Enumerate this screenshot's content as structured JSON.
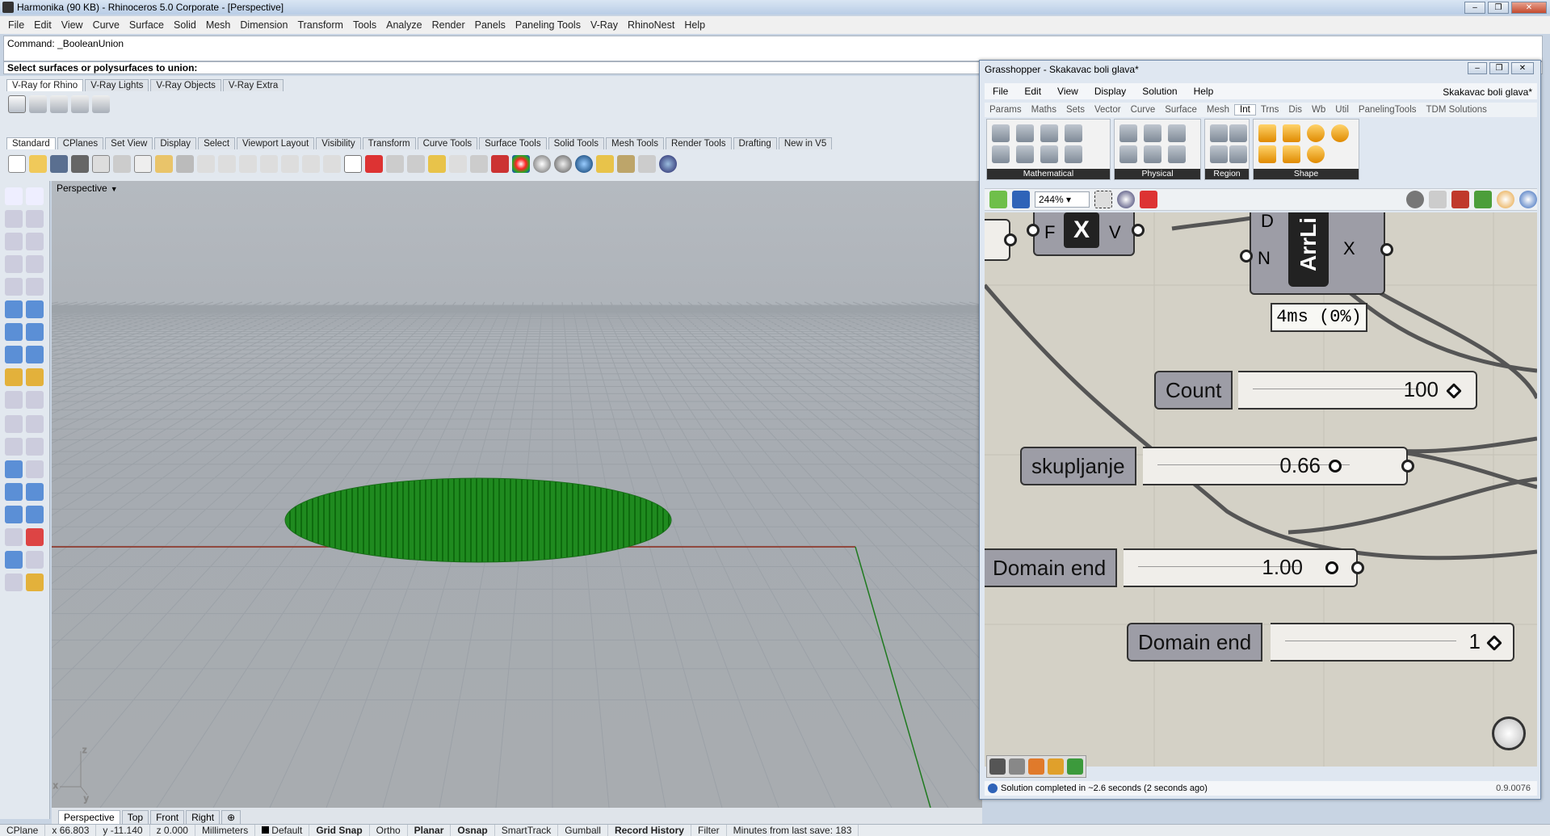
{
  "rhino": {
    "title": "Harmonika (90 KB) - Rhinoceros  5.0 Corporate - [Perspective]",
    "menu": [
      "File",
      "Edit",
      "View",
      "Curve",
      "Surface",
      "Solid",
      "Mesh",
      "Dimension",
      "Transform",
      "Tools",
      "Analyze",
      "Render",
      "Panels",
      "Paneling Tools",
      "V-Ray",
      "RhinoNest",
      "Help"
    ],
    "command_history": "Command: _BooleanUnion",
    "command_prompt": "Select surfaces or polysurfaces to union:",
    "vray_tabs": [
      "V-Ray for Rhino",
      "V-Ray Lights",
      "V-Ray Objects",
      "V-Ray Extra"
    ],
    "toolbar_tabs": [
      "Standard",
      "CPlanes",
      "Set View",
      "Display",
      "Select",
      "Viewport Layout",
      "Visibility",
      "Transform",
      "Curve Tools",
      "Surface Tools",
      "Solid Tools",
      "Mesh Tools",
      "Render Tools",
      "Drafting",
      "New in V5"
    ],
    "viewport_label": "Perspective",
    "viewport_tabs": [
      "Perspective",
      "Top",
      "Front",
      "Right"
    ],
    "add_viewport_icon": "add-tab-icon",
    "status": {
      "cplane": "CPlane",
      "x": "x 66.803",
      "y": "y -11.140",
      "z": "z 0.000",
      "units": "Millimeters",
      "layer": "Default",
      "grid_snap": "Grid Snap",
      "ortho": "Ortho",
      "planar": "Planar",
      "osnap": "Osnap",
      "smarttrack": "SmartTrack",
      "gumball": "Gumball",
      "record_history": "Record History",
      "filter": "Filter",
      "minutes": "Minutes from last save: 183"
    }
  },
  "grasshopper": {
    "title": "Grasshopper - Skakavac boli glava*",
    "menu": [
      "File",
      "Edit",
      "View",
      "Display",
      "Solution",
      "Help"
    ],
    "doc_name": "Skakavac boli glava*",
    "tabs": [
      "Params",
      "Maths",
      "Sets",
      "Vector",
      "Curve",
      "Surface",
      "Mesh",
      "Int",
      "Trns",
      "Dis",
      "Wb",
      "Util",
      "PanelingTools",
      "TDM Solutions"
    ],
    "active_tab": "Int",
    "groups": [
      "Mathematical",
      "Physical",
      "Region",
      "Shape"
    ],
    "zoom": "244%",
    "components": {
      "fxv": {
        "f": "F",
        "x": "X",
        "v": "V"
      },
      "arrlin": {
        "d": "D",
        "n": "N",
        "name": "ArrLi",
        "x": "X"
      },
      "timing": "4ms  (0%)"
    },
    "sliders": [
      {
        "label": "Count",
        "value": "100"
      },
      {
        "label": "skupljanje",
        "value": "0.66"
      },
      {
        "label": "Domain end",
        "value": "1.00"
      },
      {
        "label": "Domain end",
        "value": "1"
      }
    ],
    "status": "Solution completed in ~2.6 seconds (2 seconds ago)",
    "version": "0.9.0076"
  }
}
